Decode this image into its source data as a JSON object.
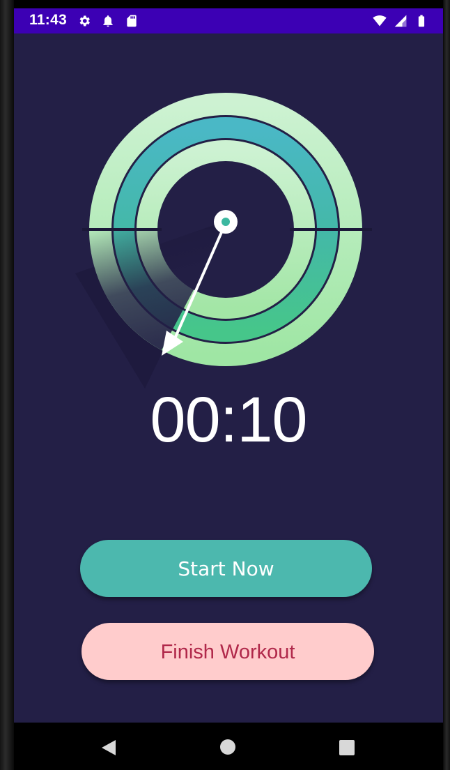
{
  "status_bar": {
    "time": "11:43",
    "left_icons": [
      "settings-icon",
      "notification-bell-icon",
      "sd-card-icon"
    ],
    "right_icons": [
      "wifi-icon",
      "cell-signal-icon",
      "battery-icon"
    ],
    "background": "#3c00b4"
  },
  "timer": {
    "display": "00:10",
    "outer_ring_color": "#c8f0cc",
    "middle_ring_color": "#46b8c0",
    "inner_ring_color": "#c6f0c8",
    "hand_color": "#ffffff",
    "background": "#231f46"
  },
  "actions": {
    "start_label": "Start Now",
    "start_color": "#4cb8ae",
    "finish_label": "Finish Workout",
    "finish_color": "#ffcccc",
    "finish_text_color": "#b0284a"
  },
  "navigation": {
    "buttons": [
      "back-icon",
      "home-icon",
      "recents-icon"
    ]
  }
}
